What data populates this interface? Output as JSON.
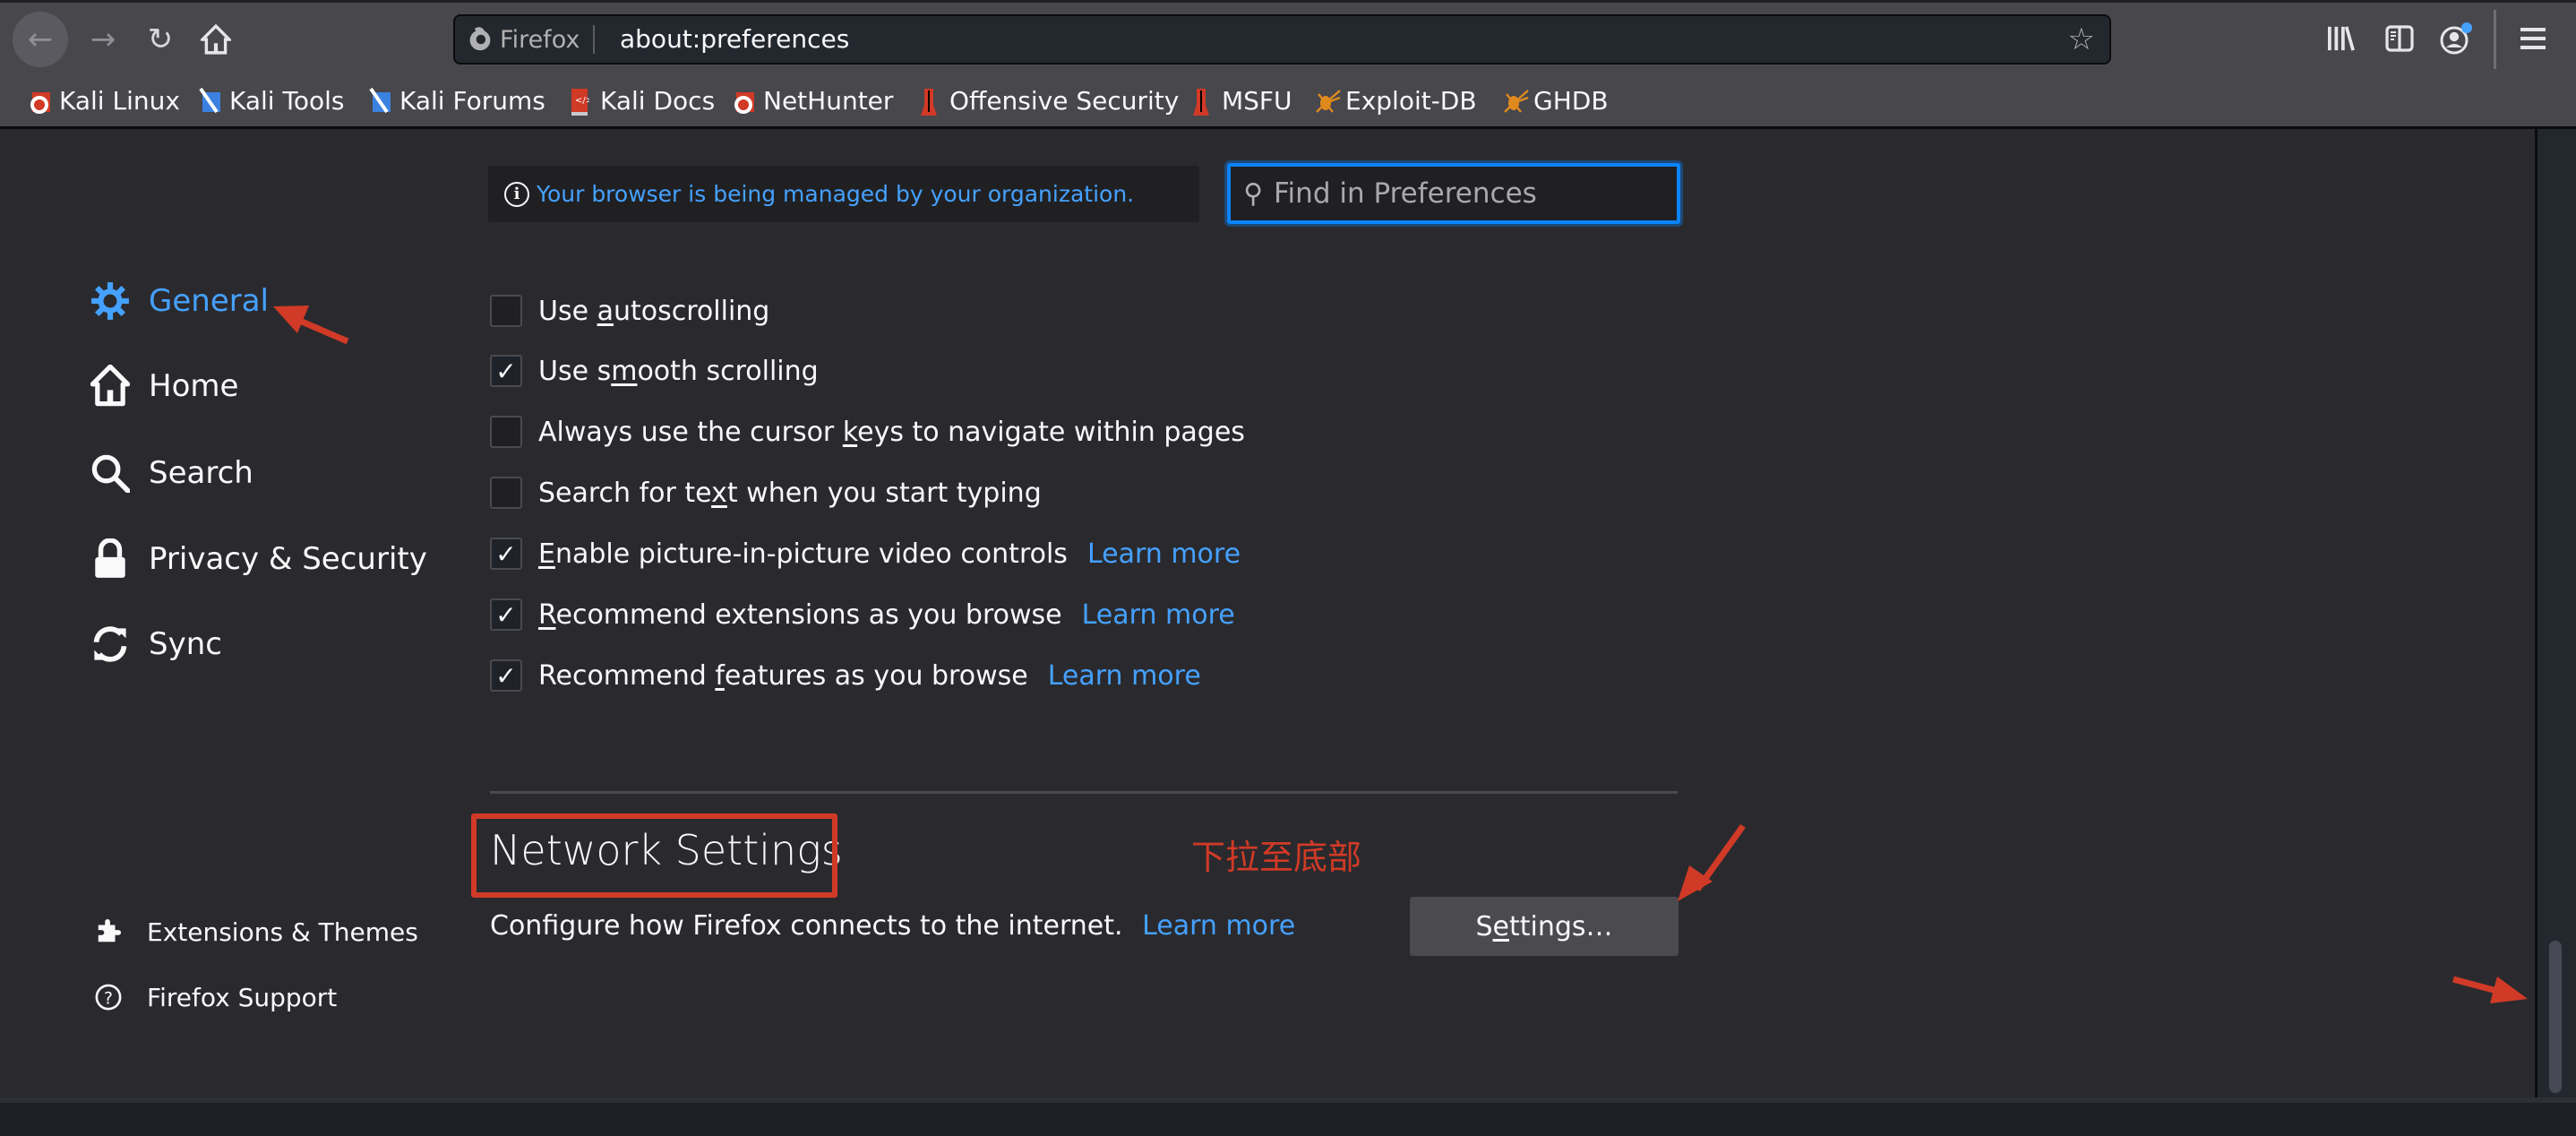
{
  "browser": {
    "identity_label": "Firefox",
    "url": "about:preferences",
    "nav": {
      "back_icon": "arrow-left-icon",
      "forward_icon": "arrow-right-icon",
      "reload_icon": "reload-icon",
      "home_icon": "home-icon"
    },
    "toolbar_icons": [
      "library-icon",
      "sidebar-icon",
      "account-icon",
      "menu-icon"
    ]
  },
  "bookmarks": [
    {
      "label": "Kali Linux",
      "icon": "kali-linux-icon"
    },
    {
      "label": "Kali Tools",
      "icon": "kali-tools-icon"
    },
    {
      "label": "Kali Forums",
      "icon": "kali-forums-icon"
    },
    {
      "label": "Kali Docs",
      "icon": "kali-docs-icon"
    },
    {
      "label": "NetHunter",
      "icon": "nethunter-icon"
    },
    {
      "label": "Offensive Security",
      "icon": "offsec-icon"
    },
    {
      "label": "MSFU",
      "icon": "msfu-icon"
    },
    {
      "label": "Exploit-DB",
      "icon": "exploit-db-icon"
    },
    {
      "label": "GHDB",
      "icon": "ghdb-icon"
    }
  ],
  "managed_notice": "Your browser is being managed by your organization.",
  "search": {
    "placeholder": "Find in Preferences",
    "value": ""
  },
  "sidebar": {
    "items": [
      {
        "label": "General",
        "icon": "gear-icon",
        "active": true
      },
      {
        "label": "Home",
        "icon": "home-icon",
        "active": false
      },
      {
        "label": "Search",
        "icon": "search-icon",
        "active": false
      },
      {
        "label": "Privacy & Security",
        "icon": "lock-icon",
        "active": false
      },
      {
        "label": "Sync",
        "icon": "sync-icon",
        "active": false
      }
    ],
    "footer": [
      {
        "label": "Extensions & Themes",
        "icon": "puzzle-icon"
      },
      {
        "label": "Firefox Support",
        "icon": "help-icon"
      }
    ]
  },
  "browsing": {
    "options": [
      {
        "pre": "Use ",
        "key": "a",
        "post": "utoscrolling",
        "checked": false,
        "learn_more": ""
      },
      {
        "pre": "Use s",
        "key": "m",
        "post": "ooth scrolling",
        "checked": true,
        "learn_more": ""
      },
      {
        "pre": "Always use the cursor ",
        "key": "k",
        "post": "eys to navigate within pages",
        "checked": false,
        "learn_more": ""
      },
      {
        "pre": "Search for te",
        "key": "x",
        "post": "t when you start typing",
        "checked": false,
        "learn_more": ""
      },
      {
        "pre": "",
        "key": "E",
        "post": "nable picture-in-picture video controls",
        "checked": true,
        "learn_more": "Learn more"
      },
      {
        "pre": "",
        "key": "R",
        "post": "ecommend extensions as you browse",
        "checked": true,
        "learn_more": "Learn more"
      },
      {
        "pre": "Recommend ",
        "key": "f",
        "post": "eatures as you browse",
        "checked": true,
        "learn_more": "Learn more"
      }
    ]
  },
  "network": {
    "heading": "Network Settings",
    "description": "Configure how Firefox connects to the internet.",
    "learn_more": "Learn more",
    "button_pre": "S",
    "button_key": "e",
    "button_post": "ttings…"
  },
  "annotations": {
    "note": "下拉至底部",
    "color": "#d13a26"
  },
  "colors": {
    "accent": "#45a1ff",
    "focus": "#0a84ff",
    "toolbar": "#47474c",
    "content_bg": "#2a2a2e"
  }
}
